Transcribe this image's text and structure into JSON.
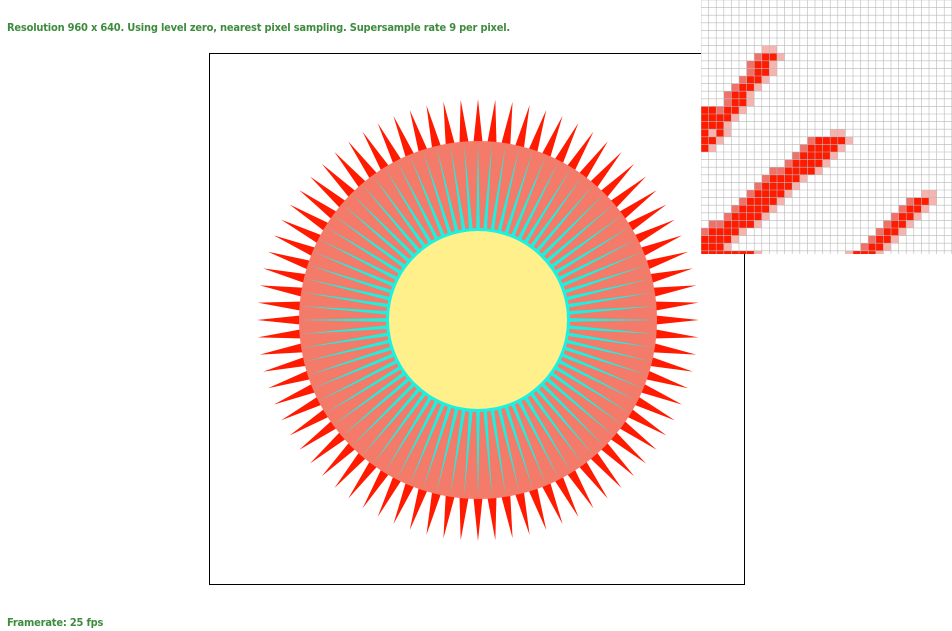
{
  "header": {
    "status_text": "Resolution 960 x 640. Using level zero, nearest pixel sampling. Supersample rate 9 per pixel."
  },
  "footer": {
    "framerate_text": "Framerate: 25 fps"
  },
  "colors": {
    "status_text": "#3d8c3d",
    "spikes": "#ff1a00",
    "salmon_disc": "#f47a6a",
    "cyan_ring": "#1ef0e0",
    "yellow_center": "#fff08c",
    "zoom_grid": "#b8b8b8",
    "zoom_red": "#ff1a00",
    "zoom_light": "#f7b3ad",
    "zoom_mid": "#f0706a"
  },
  "scene": {
    "outer_spike_count": 80,
    "inner_spike_count": 80
  }
}
